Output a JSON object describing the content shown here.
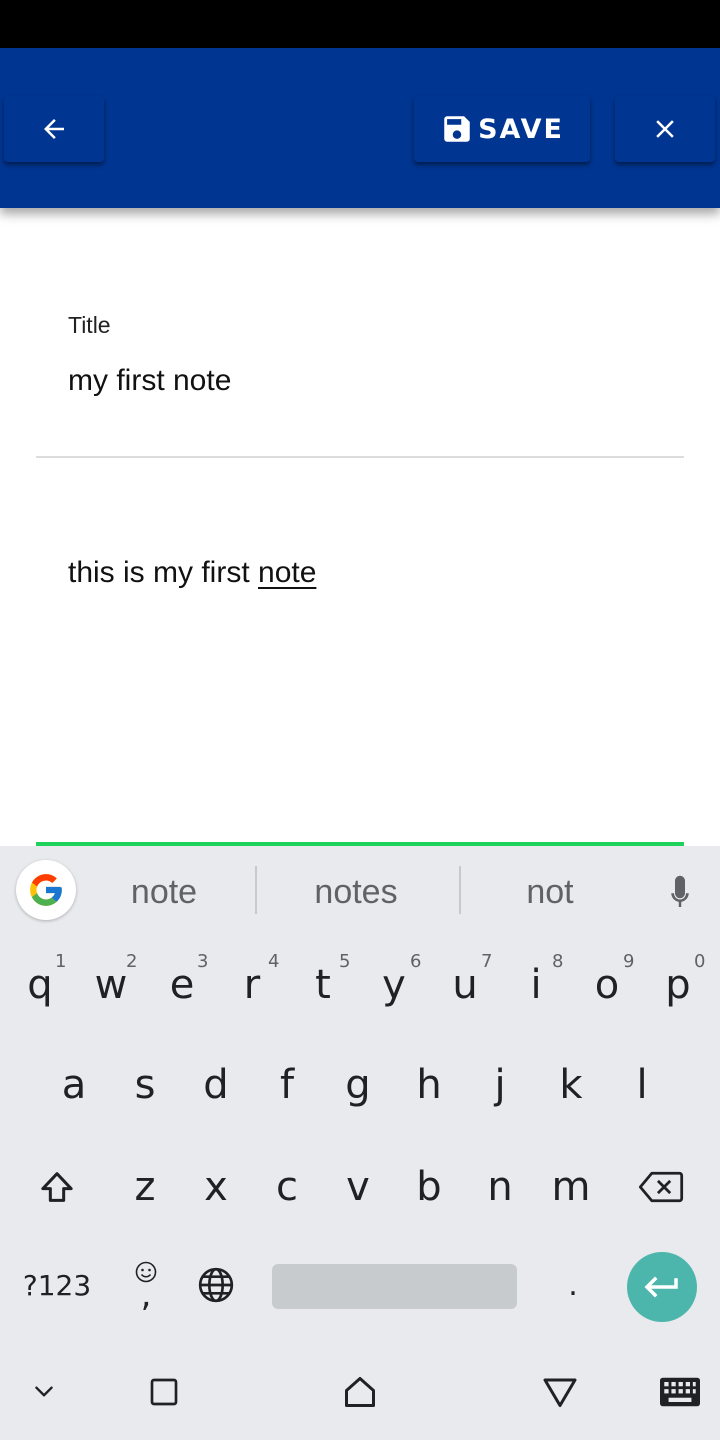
{
  "appbar": {
    "save_label": "SAVE",
    "color": "#003591"
  },
  "editor": {
    "title_label": "Title",
    "title_value": "my first note",
    "body_text_before": "this is my first ",
    "body_text_underlined": "note",
    "focus_color": "#1fd35a"
  },
  "keyboard": {
    "suggestions": [
      "note",
      "notes",
      "not"
    ],
    "row1": [
      {
        "key": "q",
        "hint": "1"
      },
      {
        "key": "w",
        "hint": "2"
      },
      {
        "key": "e",
        "hint": "3"
      },
      {
        "key": "r",
        "hint": "4"
      },
      {
        "key": "t",
        "hint": "5"
      },
      {
        "key": "y",
        "hint": "6"
      },
      {
        "key": "u",
        "hint": "7"
      },
      {
        "key": "i",
        "hint": "8"
      },
      {
        "key": "o",
        "hint": "9"
      },
      {
        "key": "p",
        "hint": "0"
      }
    ],
    "row2": [
      "a",
      "s",
      "d",
      "f",
      "g",
      "h",
      "j",
      "k",
      "l"
    ],
    "row3": [
      "z",
      "x",
      "c",
      "v",
      "b",
      "n",
      "m"
    ],
    "symbols_label": "?123",
    "comma": ",",
    "period": ".",
    "enter_color": "#4db6ac",
    "icons": [
      "shift-icon",
      "backspace-icon",
      "emoji-icon",
      "globe-icon",
      "enter-icon",
      "mic-icon",
      "google-icon"
    ]
  },
  "navbar": {
    "icons": [
      "hide-keyboard-icon",
      "recents-icon",
      "home-icon",
      "back-icon",
      "keyboard-switch-icon"
    ]
  }
}
